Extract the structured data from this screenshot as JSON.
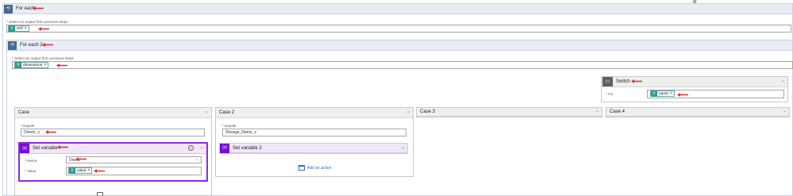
{
  "foreach1": {
    "title": "For each",
    "field_label": "* Select an output from previous steps",
    "token": "#Of"
  },
  "foreach2": {
    "title": "For each 2",
    "field_label": "* Select an output from previous steps",
    "token": "dimensions"
  },
  "switch": {
    "title": "Switch",
    "on_label": "* On",
    "token": "name"
  },
  "case1": {
    "title": "Case",
    "equals_label": "* Equals",
    "equals_value": "Owner_s",
    "action": {
      "title": "Set variable",
      "name_label": "* Name",
      "name_value": "Owner",
      "value_label": "* Value",
      "value_token": "value"
    }
  },
  "case2": {
    "title": "Case 2",
    "equals_label": "* Equals",
    "equals_value": "Storage_Name_s",
    "action": {
      "title": "Set variable 2"
    },
    "add_action": "Add an action"
  },
  "case3": {
    "title": "Case 3"
  },
  "case4": {
    "title": "Case 4"
  },
  "icons": {
    "foreach": "loop-icon",
    "switch": "switch-icon",
    "variable": "variable-icon",
    "token": "token-icon",
    "info": "info-icon",
    "add": "add-action-icon"
  },
  "colors": {
    "foreach_header": "#e8ecf4",
    "loop_icon": "#486991",
    "variable_icon": "#770bd6",
    "variable_border": "#8a2be2",
    "token_icon": "#2b9c93",
    "arrow": "#e0302a"
  }
}
